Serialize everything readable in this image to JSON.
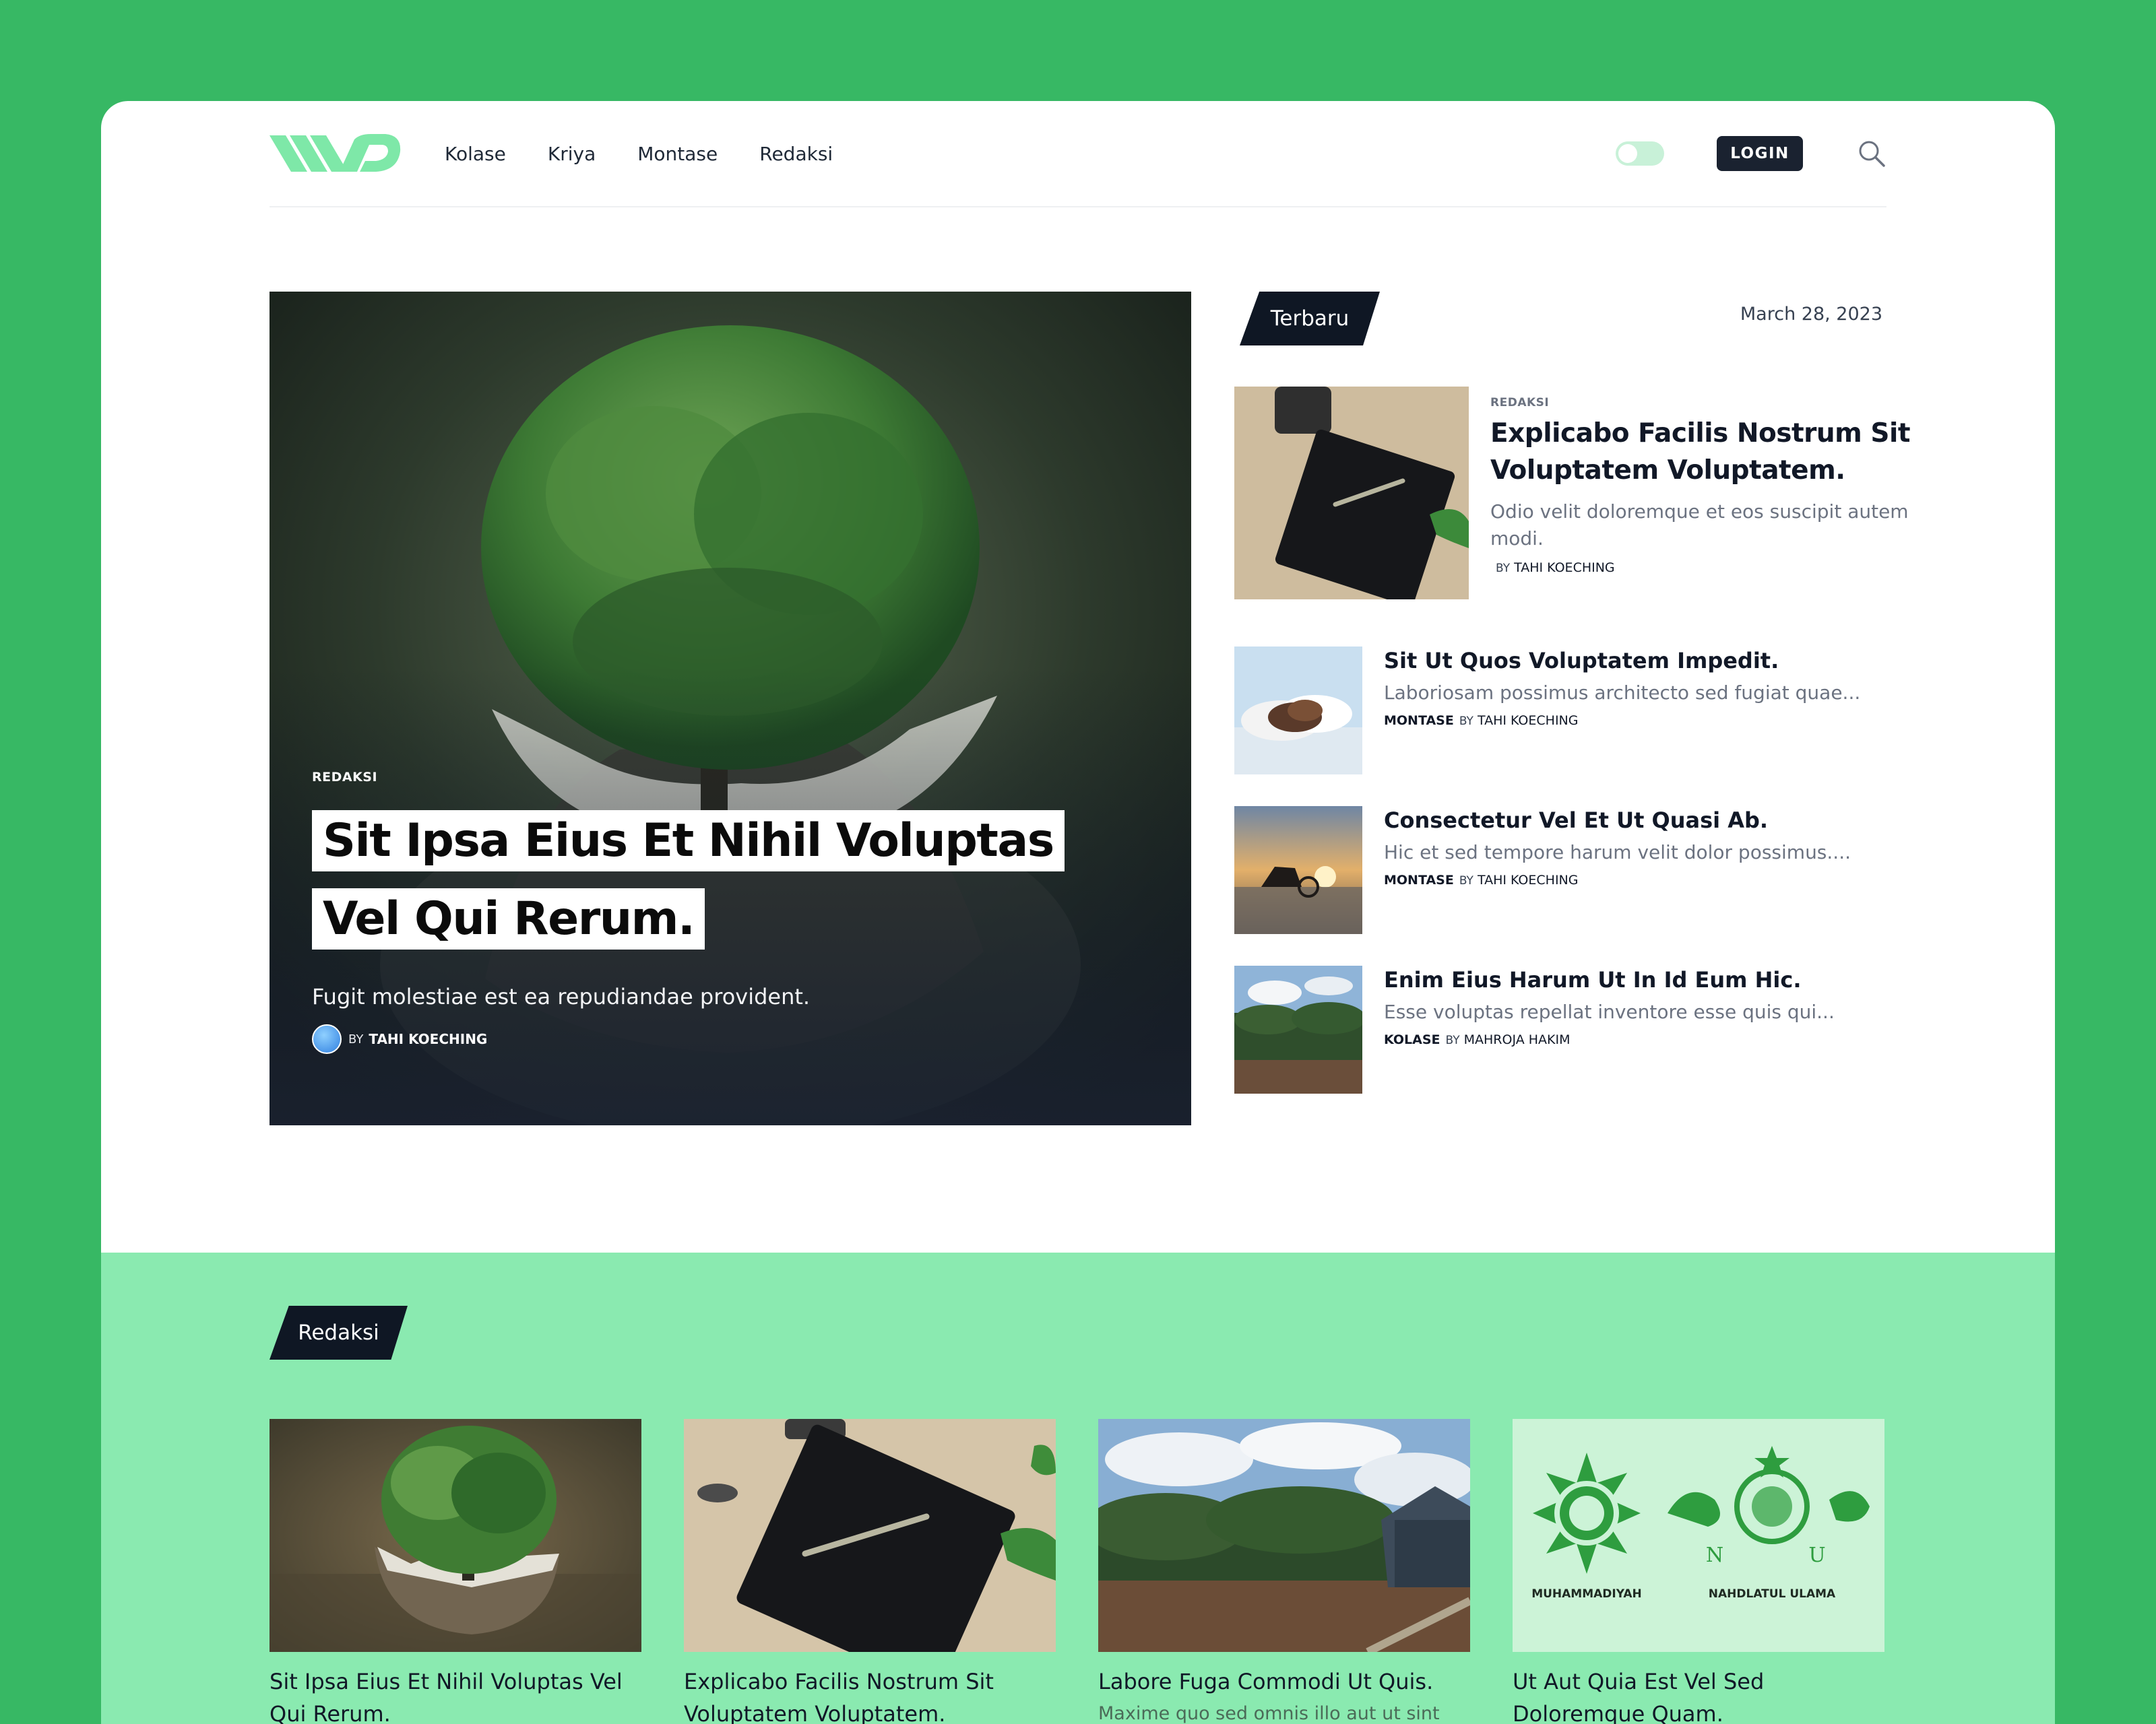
{
  "nav": {
    "items": [
      "Kolase",
      "Kriya",
      "Montase",
      "Redaksi"
    ],
    "login_label": "LOGIN",
    "theme_toggle": "off"
  },
  "hero": {
    "category": "REDAKSI",
    "title": "Sit Ipsa Eius Et Nihil Voluptas Vel Qui Rerum.",
    "excerpt": "Fugit molestiae est ea repudiandae provident.",
    "by": "BY",
    "author": "TAHI KOECHING"
  },
  "latest": {
    "tag": "Terbaru",
    "date": "March 28, 2023",
    "featured": {
      "category": "REDAKSI",
      "title": "Explicabo Facilis Nostrum Sit Voluptatem Voluptatem.",
      "excerpt": "Odio velit doloremque et eos suscipit autem modi.",
      "by": "BY",
      "author": "TAHI KOECHING"
    },
    "items": [
      {
        "title": "Sit Ut Quos Voluptatem Impedit.",
        "excerpt": "Laboriosam possimus architecto sed fugiat quae...",
        "category": "MONTASE",
        "by": "BY",
        "author": "TAHI KOECHING"
      },
      {
        "title": "Consectetur Vel Et Ut Quasi Ab.",
        "excerpt": "Hic et sed tempore harum velit dolor possimus....",
        "category": "MONTASE",
        "by": "BY",
        "author": "TAHI KOECHING"
      },
      {
        "title": "Enim Eius Harum Ut In Id Eum Hic.",
        "excerpt": "Esse voluptas repellat inventore esse quis qui...",
        "category": "KOLASE",
        "by": "BY",
        "author": "MAHROJA HAKIM"
      }
    ]
  },
  "section": {
    "tag": "Redaksi",
    "cards": [
      {
        "title": "Sit Ipsa Eius Et Nihil Voluptas Vel Qui Rerum.",
        "excerpt": ""
      },
      {
        "title": "Explicabo Facilis Nostrum Sit Voluptatem Voluptatem.",
        "excerpt": ""
      },
      {
        "title": "Labore Fuga Commodi Ut Quis.",
        "excerpt": "Maxime quo sed omnis illo aut ut sint"
      },
      {
        "title": "Ut Aut Quia Est Vel Sed Doloremque Quam.",
        "excerpt": ""
      }
    ],
    "logo_labels": [
      "MUHAMMADIYAH",
      "NAHDLATUL ULAMA",
      "N",
      "U"
    ]
  },
  "colors": {
    "background": "#37b864",
    "accent": "#8aeab0",
    "dark": "#0f1724"
  }
}
